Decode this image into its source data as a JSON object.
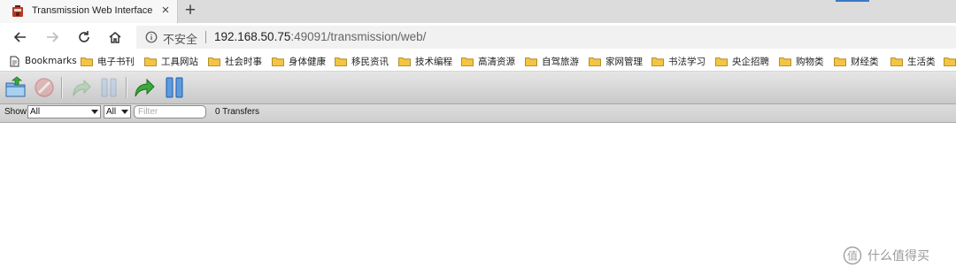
{
  "browser": {
    "tab_title": "Transmission Web Interface",
    "tab_close": "×",
    "new_tab": "+",
    "insecure_label": "不安全",
    "url_host": "192.168.50.75",
    "url_rest": ":49091/transmission/web/"
  },
  "bookmarks": [
    {
      "label": "Bookmarks",
      "icon": "bookmarks-icon"
    },
    {
      "label": "电子书刊",
      "icon": "folder-icon"
    },
    {
      "label": "工具网站",
      "icon": "folder-icon"
    },
    {
      "label": "社会时事",
      "icon": "folder-icon"
    },
    {
      "label": "身体健康",
      "icon": "folder-icon"
    },
    {
      "label": "移民资讯",
      "icon": "folder-icon"
    },
    {
      "label": "技术编程",
      "icon": "folder-icon"
    },
    {
      "label": "高清资源",
      "icon": "folder-icon"
    },
    {
      "label": "自驾旅游",
      "icon": "folder-icon"
    },
    {
      "label": "家网管理",
      "icon": "folder-icon"
    },
    {
      "label": "书法学习",
      "icon": "folder-icon"
    },
    {
      "label": "央企招聘",
      "icon": "folder-icon"
    },
    {
      "label": "购物类",
      "icon": "folder-icon"
    },
    {
      "label": "财经类",
      "icon": "folder-icon"
    },
    {
      "label": "生活类",
      "icon": "folder-icon"
    }
  ],
  "toolbar": {
    "buttons": [
      {
        "name": "open-torrent-icon",
        "enabled": true
      },
      {
        "name": "remove-torrent-icon",
        "enabled": false
      },
      {
        "name": "resume-torrent-icon",
        "enabled": false
      },
      {
        "name": "pause-torrent-icon",
        "enabled": false
      },
      {
        "name": "resume-all-icon",
        "enabled": true
      },
      {
        "name": "pause-all-icon",
        "enabled": true
      }
    ]
  },
  "filterbar": {
    "show_label": "Show",
    "status_filter": "All",
    "tracker_filter": "All",
    "filter_placeholder": "Filter",
    "transfers_count": "0 Transfers"
  },
  "watermark": {
    "text": "什么值得买"
  },
  "colors": {
    "toolbar_top": "#e6e6e6",
    "toolbar_bottom": "#c9c9c9",
    "accent_blue": "#3b78c8",
    "green": "#3aa93a"
  }
}
